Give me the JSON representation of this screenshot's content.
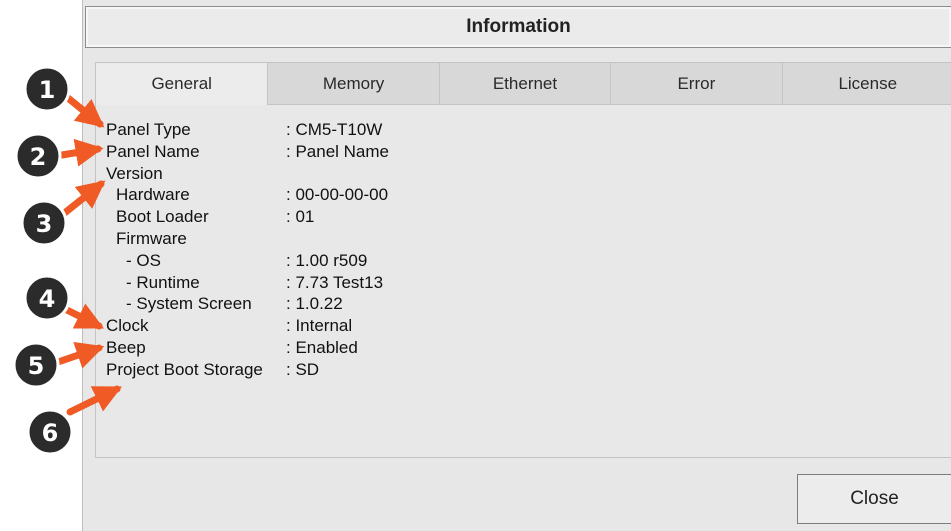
{
  "dialog": {
    "title": "Information",
    "tabs": [
      {
        "label": "General",
        "active": true
      },
      {
        "label": "Memory",
        "active": false
      },
      {
        "label": "Ethernet",
        "active": false
      },
      {
        "label": "Error",
        "active": false
      },
      {
        "label": "License",
        "active": false
      }
    ],
    "general": {
      "panel_type": {
        "label": "Panel Type",
        "value": ": CM5-T10W"
      },
      "panel_name": {
        "label": "Panel Name",
        "value": ": Panel Name"
      },
      "version": {
        "label": "Version"
      },
      "hardware": {
        "label": "Hardware",
        "value": ": 00-00-00-00"
      },
      "boot_loader": {
        "label": "Boot Loader",
        "value": ": 01"
      },
      "firmware": {
        "label": "Firmware"
      },
      "os": {
        "label": "- OS",
        "value": ": 1.00 r509"
      },
      "runtime": {
        "label": "- Runtime",
        "value": ": 7.73 Test13"
      },
      "system_screen": {
        "label": "- System Screen",
        "value": ": 1.0.22"
      },
      "clock": {
        "label": "Clock",
        "value": ": Internal"
      },
      "beep": {
        "label": "Beep",
        "value": ": Enabled"
      },
      "project_boot_storage": {
        "label": "Project Boot Storage",
        "value": ": SD"
      }
    },
    "close_label": "Close"
  },
  "callouts": [
    "1",
    "2",
    "3",
    "4",
    "5",
    "6"
  ],
  "colors": {
    "callout_arrow": "#f05a24",
    "callout_badge": "#2b2b2b"
  }
}
